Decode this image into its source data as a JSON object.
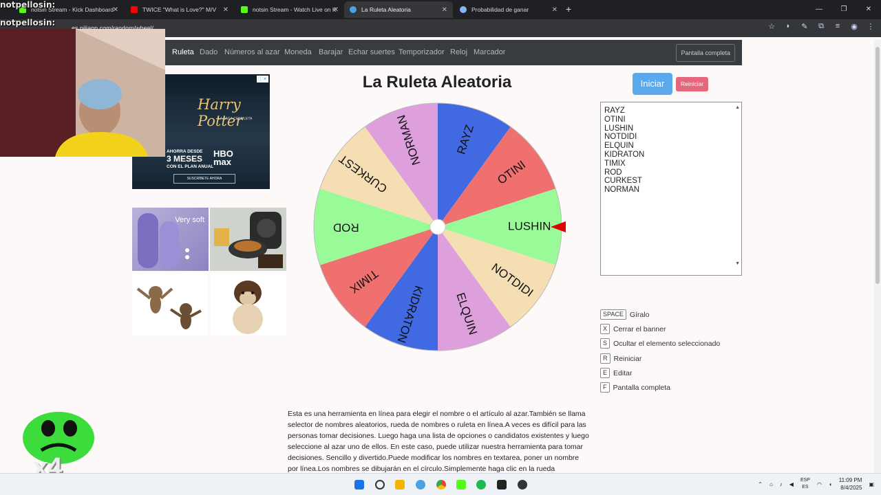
{
  "browser": {
    "tabs": [
      {
        "title": "notsin Stream - Kick Dashboard",
        "color": "#53fc18"
      },
      {
        "title": "TWICE \"What is Love?\" M/V",
        "color": "#ff0000"
      },
      {
        "title": "notsin Stream - Watch Live on K",
        "color": "#53fc18"
      },
      {
        "title": "La Ruleta Aleatoria",
        "color": "#4aa3df"
      },
      {
        "title": "Probabilidad de ganar",
        "color": "#8ab4f8"
      }
    ],
    "url": "es.piliapp.com/random/wheel/"
  },
  "nav": {
    "items": [
      "Ruleta",
      "Dado",
      "Números al azar",
      "Moneda",
      "Barajar",
      "Echar suertes",
      "Temporizador",
      "Reloj",
      "Marcador"
    ],
    "fullscreen_label": "Pantalla completa"
  },
  "ads": {
    "hp_title": "Harry Potter",
    "hp_subtitle": "LA SAGA COMPLETA",
    "hp_promo_line1": "AHORRA DESDE",
    "hp_promo_big": "3 MESES",
    "hp_promo_line2": "CON EL PLAN ANUAL",
    "hp_logo": "HBO max",
    "hp_cta": "SUSCRÍBETE AHORA",
    "slipper_text": "Very soft"
  },
  "main": {
    "title": "La Ruleta Aleatoria",
    "start_label": "Iniciar",
    "reset_label": "Reiniciar",
    "names": [
      "RAYZ",
      "OTINI",
      "LUSHIN",
      "NOTDIDI",
      "ELQUIN",
      "KIDRATON",
      "TIMIX",
      "ROD",
      "CURKEST",
      "NORMAN"
    ],
    "names_text": "RAYZ\nOTINI\nLUSHIN\nNOTDIDI\nELQUIN\nKIDRATON\nTIMIX\nROD\nCURKEST\nNORMAN",
    "wheel_colors": [
      "#4169e1",
      "#f07070",
      "#98fb98",
      "#f5deb3",
      "#dda0dd"
    ],
    "pointer_color": "#e00000",
    "shortcuts": [
      {
        "key": "SPACE",
        "label": "Gíralo"
      },
      {
        "key": "X",
        "label": "Cerrar el banner"
      },
      {
        "key": "S",
        "label": "Ocultar el elemento seleccionado"
      },
      {
        "key": "R",
        "label": "Reiniciar"
      },
      {
        "key": "E",
        "label": "Editar"
      },
      {
        "key": "F",
        "label": "Pantalla completa"
      }
    ],
    "description": "Esta es una herramienta en línea para elegir el nombre o el artículo al azar.También se llama selector de nombres aleatorios, rueda de nombres o ruleta en línea.A veces es difícil para las personas tomar decisiones. Luego haga una lista de opciones o candidatos existentes y luego seleccione al azar uno de ellos. En este caso, puede utilizar nuestra herramienta para tomar decisiones. Sencillo y divertido.Puede modificar los nombres en textarea, poner un nombre por línea.Los nombres se dibujarán en el círculo.Simplemente haga clic en la rueda"
  },
  "overlay": {
    "chat": [
      "notpellosin:",
      "notpellosin:"
    ],
    "emote_text": "x4"
  },
  "taskbar": {
    "lang_top": "ESP",
    "lang_bottom": "ES",
    "time": "11:09 PM",
    "date": "8/4/2025"
  }
}
